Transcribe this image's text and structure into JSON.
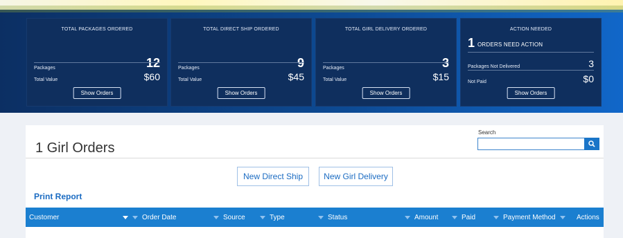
{
  "cards": [
    {
      "title": "TOTAL PACKAGES ORDERED",
      "packages_label": "Packages",
      "packages_value": "12",
      "value_label": "Total Value",
      "value_value": "$60",
      "button": "Show Orders"
    },
    {
      "title": "TOTAL DIRECT SHIP ORDERED",
      "packages_label": "Packages",
      "packages_value": "9",
      "value_label": "Total Value",
      "value_value": "$45",
      "button": "Show Orders"
    },
    {
      "title": "TOTAL GIRL DELIVERY ORDERED",
      "packages_label": "Packages",
      "packages_value": "3",
      "value_label": "Total Value",
      "value_value": "$15",
      "button": "Show Orders"
    }
  ],
  "action_card": {
    "title": "ACTION NEEDED",
    "count": "1",
    "count_text": "ORDERS NEED ACTION",
    "not_delivered_label": "Packages Not Delivered",
    "not_delivered_value": "3",
    "not_paid_label": "Not Paid",
    "not_paid_value": "$0",
    "button": "Show Orders"
  },
  "main": {
    "title": "1 Girl Orders",
    "search_label": "Search",
    "search_value": "",
    "new_direct_ship": "New Direct Ship",
    "new_girl_delivery": "New Girl Delivery",
    "print_report": "Print Report"
  },
  "table": {
    "columns": [
      "Customer",
      "Order Date",
      "Source",
      "Type",
      "Status",
      "Amount",
      "Paid",
      "Payment Method",
      "Actions"
    ]
  },
  "colors": {
    "banner_dark": "#0c2f63",
    "banner_light": "#1167c9",
    "card_bg": "#0f2f5e",
    "table_header": "#1b7fd0",
    "link_blue": "#1a6bc2"
  },
  "icons": {
    "search": "search-icon",
    "filter": "filter-icon",
    "sort": "sort-desc-icon"
  }
}
